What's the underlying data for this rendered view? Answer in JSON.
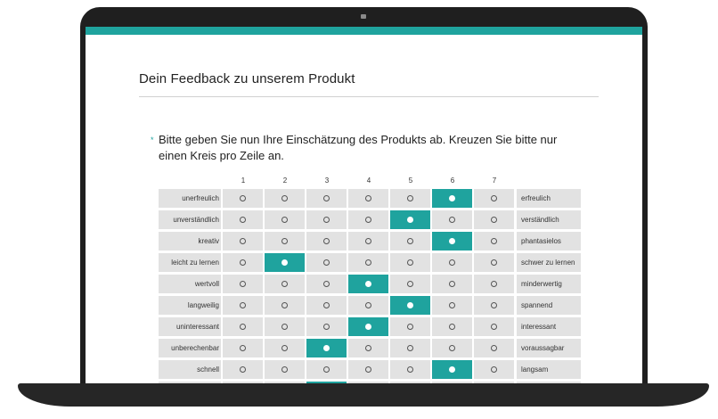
{
  "page": {
    "title": "Dein Feedback zu unserem Produkt",
    "question": "Bitte geben Sie nun Ihre Einschätzung des Produkts ab. Kreuzen Sie bitte nur einen Kreis pro Zeile an.",
    "question_marker": "*",
    "accent_color": "#1fa39e"
  },
  "scale": [
    "1",
    "2",
    "3",
    "4",
    "5",
    "6",
    "7"
  ],
  "rows": [
    {
      "left": "unerfreulich",
      "right": "erfreulich",
      "selected": 6
    },
    {
      "left": "unverständlich",
      "right": "verständlich",
      "selected": 5
    },
    {
      "left": "kreativ",
      "right": "phantasielos",
      "selected": 6
    },
    {
      "left": "leicht zu lernen",
      "right": "schwer zu lernen",
      "selected": 2
    },
    {
      "left": "wertvoll",
      "right": "minderwertig",
      "selected": 4
    },
    {
      "left": "langweilig",
      "right": "spannend",
      "selected": 5
    },
    {
      "left": "uninteressant",
      "right": "interessant",
      "selected": 4
    },
    {
      "left": "unberechenbar",
      "right": "voraussagbar",
      "selected": 3
    },
    {
      "left": "schnell",
      "right": "langsam",
      "selected": 6
    },
    {
      "left": "",
      "right": "",
      "selected": 3
    }
  ]
}
